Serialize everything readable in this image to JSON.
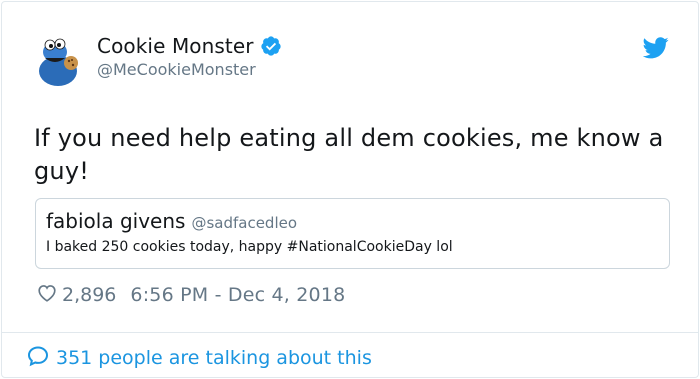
{
  "author": {
    "display_name": "Cookie Monster",
    "handle": "@MeCookieMonster",
    "verified": true
  },
  "tweet": {
    "text": "If you need help eating all dem cookies, me know a guy!"
  },
  "quoted_tweet": {
    "display_name": "fabiola givens",
    "handle": "@sadfacedleo",
    "text": "I baked 250 cookies today, happy #NationalCookieDay lol"
  },
  "stats": {
    "likes": "2,896",
    "timestamp": "6:56 PM - Dec 4, 2018"
  },
  "footer": {
    "talking_label": "351 people are talking about this"
  },
  "colors": {
    "accent": "#1da1f2",
    "link": "#1b95e0",
    "muted": "#657786",
    "avatar_blue": "#2b6cb8"
  },
  "icons": {
    "verified": "verified-badge-icon",
    "brand": "twitter-bird-icon",
    "like": "heart-icon",
    "reply": "speech-bubble-icon"
  }
}
